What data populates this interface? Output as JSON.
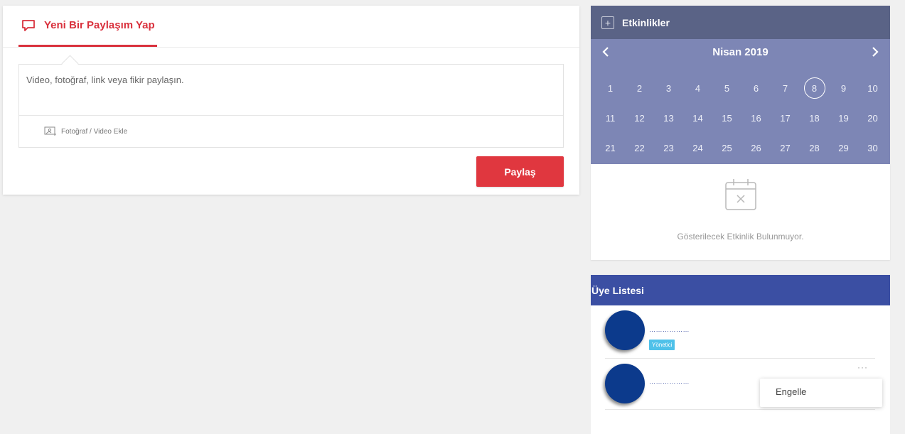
{
  "post": {
    "tab_label": "Yeni Bir Paylaşım Yap",
    "placeholder": "Video, fotoğraf, link veya fikir paylaşın.",
    "attach_label": "Fotoğraf / Video Ekle",
    "share_label": "Paylaş"
  },
  "events": {
    "title": "Etkinlikler",
    "plus": "+",
    "month": "Nisan 2019",
    "prev": "<",
    "next": ">",
    "today": 8,
    "days": [
      1,
      2,
      3,
      4,
      5,
      6,
      7,
      8,
      9,
      10,
      11,
      12,
      13,
      14,
      15,
      16,
      17,
      18,
      19,
      20,
      21,
      22,
      23,
      24,
      25,
      26,
      27,
      28,
      29,
      30
    ],
    "empty_text": "Gösterilecek Etkinlik Bulunmuyor."
  },
  "members": {
    "title": "Üye Listesi",
    "list": [
      {
        "name": "………………",
        "badge": "Yönetici"
      },
      {
        "name": "………………",
        "more": "···"
      }
    ],
    "menu_item": "Engelle"
  },
  "colors": {
    "accent_red": "#e0373f",
    "events_header": "#5a6386",
    "calendar_bg": "#7d86b5",
    "members_header": "#3b4fa3",
    "avatar": "#0c3a8c",
    "badge": "#4fc1e9"
  }
}
